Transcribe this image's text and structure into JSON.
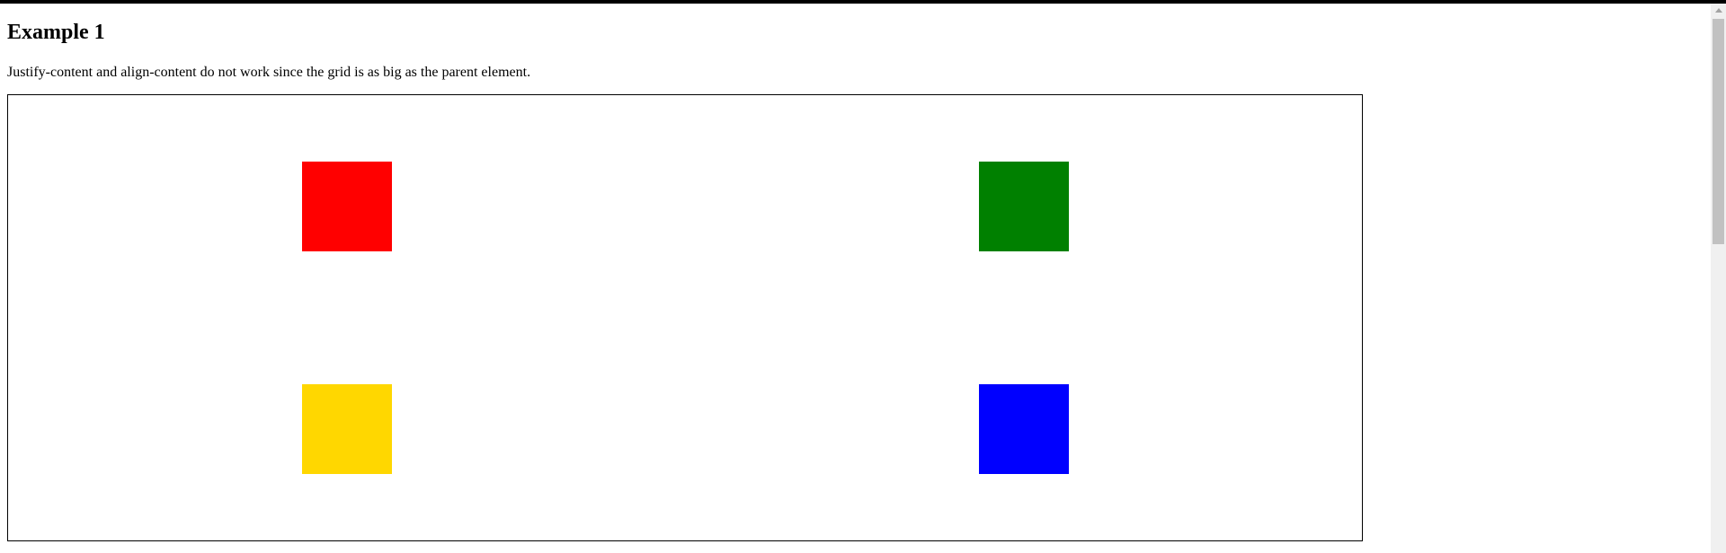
{
  "page": {
    "heading": "Example 1",
    "description": "Justify-content and align-content do not work since the grid is as big as the parent element."
  },
  "grid": {
    "items": [
      {
        "name": "red-square",
        "color": "#ff0000"
      },
      {
        "name": "green-square",
        "color": "#008000"
      },
      {
        "name": "yellow-square",
        "color": "#ffd700"
      },
      {
        "name": "blue-square",
        "color": "#0000ff"
      }
    ]
  },
  "scrollbar": {
    "up_icon": "chevron-up-icon"
  }
}
